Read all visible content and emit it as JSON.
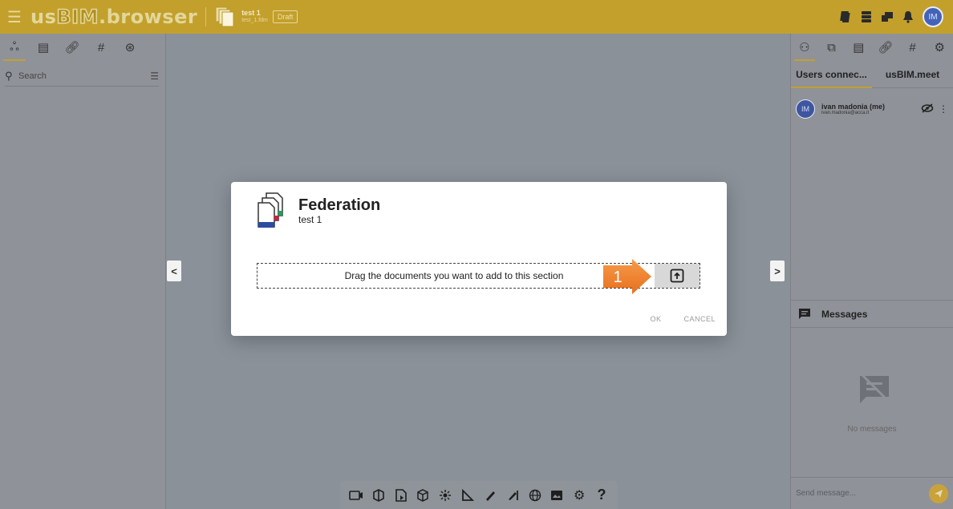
{
  "app": {
    "logo_part1": "us",
    "logo_part2": "BIM",
    "logo_part3": ".browser",
    "project_name": "test 1",
    "project_file": "test_1.fdm",
    "status_badge": "Draft",
    "user_initials": "IM"
  },
  "left_panel": {
    "tabs": [
      "model-tree",
      "documents",
      "links",
      "tags",
      "filters"
    ],
    "search_placeholder": "Search"
  },
  "right_panel": {
    "subtabs": [
      "Users connec...",
      "usBIM.meet"
    ],
    "users": [
      {
        "initials": "IM",
        "name": "ivan madonia (me)",
        "email": "ivan.madonia@acca.it"
      }
    ],
    "messages_title": "Messages",
    "no_messages": "No messages",
    "send_placeholder": "Send message..."
  },
  "modal": {
    "title": "Federation",
    "subtitle": "test 1",
    "drop_text": "Drag the documents you want to add to this section",
    "callout_number": "1",
    "ok_label": "OK",
    "cancel_label": "CANCEL"
  },
  "toolbar": {
    "tools": [
      "camera",
      "section",
      "document",
      "cube",
      "explode",
      "measure",
      "draw",
      "annotate",
      "globe",
      "image",
      "settings",
      "help"
    ],
    "help_label": "?"
  },
  "colors": {
    "accent": "#c3a02c",
    "overlay": "#8a9199",
    "callout": "#f07f2a"
  }
}
